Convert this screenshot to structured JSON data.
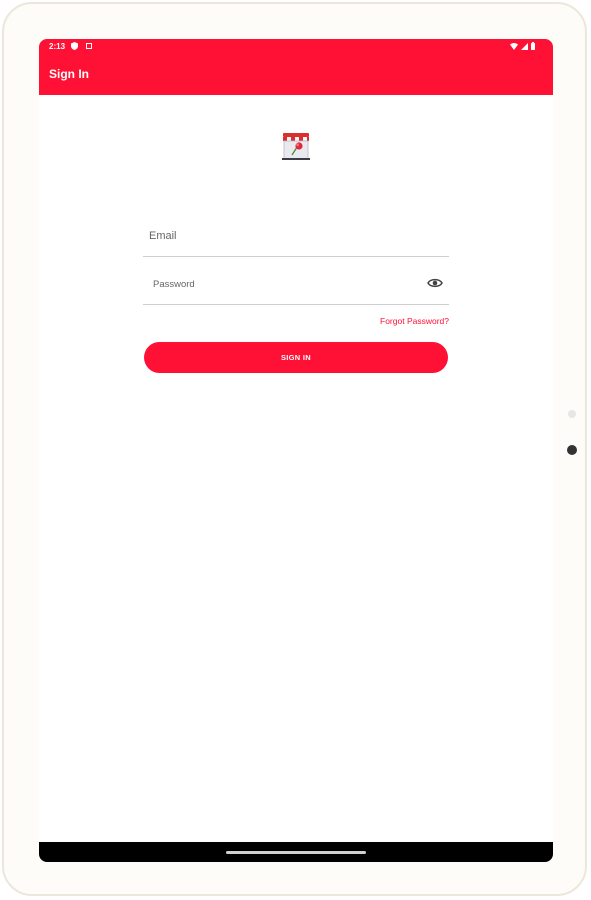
{
  "status_bar": {
    "time": "2:13",
    "icons": [
      "shield-icon",
      "notification-icon",
      "wifi-icon",
      "signal-icon",
      "battery-icon"
    ]
  },
  "app_bar": {
    "title": "Sign In"
  },
  "logo": {
    "icon": "store-icon"
  },
  "form": {
    "email": {
      "placeholder": "Email",
      "value": ""
    },
    "password": {
      "placeholder": "Password",
      "value": "",
      "toggle_icon": "eye-icon"
    },
    "forgot_password": "Forgot Password?",
    "submit_label": "SIGN IN"
  },
  "colors": {
    "accent": "#ff1035",
    "nav_bar": "#000000",
    "background": "#ffffff"
  }
}
